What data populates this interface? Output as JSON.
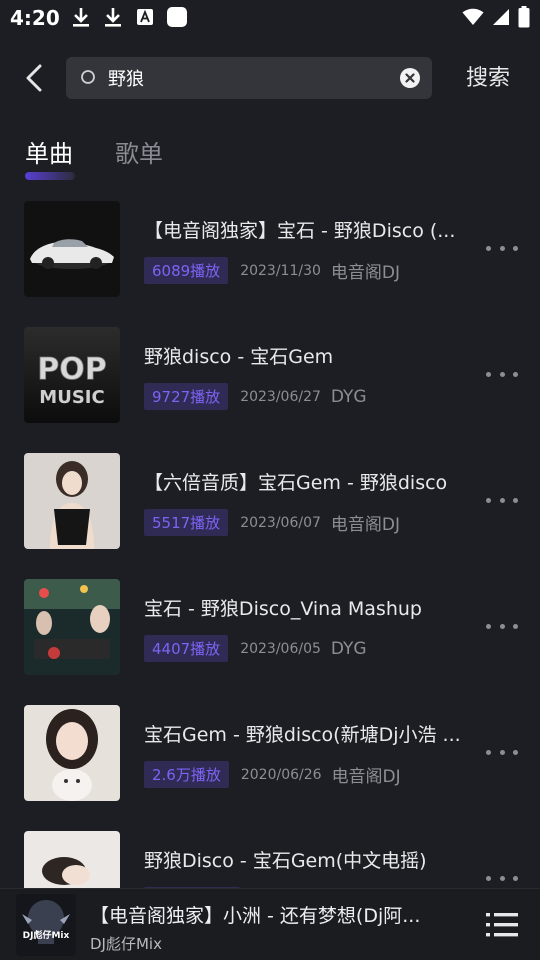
{
  "status_bar": {
    "time": "4:20",
    "left_icons": [
      "download-icon",
      "download-icon",
      "text-a-icon",
      "square-app-icon"
    ],
    "right_icons": [
      "wifi-icon",
      "signal-icon",
      "battery-icon"
    ]
  },
  "search": {
    "value": "野狼",
    "placeholder": "",
    "submit_label": "搜索"
  },
  "tabs": [
    {
      "label": "单曲",
      "active": true
    },
    {
      "label": "歌单",
      "active": false
    }
  ],
  "songs": [
    {
      "title": "【电音阁独家】宝石 - 野狼Disco (...",
      "plays": "6089播放",
      "date": "2023/11/30",
      "artist": "电音阁DJ",
      "cover": "car"
    },
    {
      "title": "野狼disco - 宝石Gem",
      "plays": "9727播放",
      "date": "2023/06/27",
      "artist": "DYG",
      "cover": "pop",
      "cover_text_1": "POP",
      "cover_text_2": "MUSIC"
    },
    {
      "title": "【六倍音质】宝石Gem - 野狼disco",
      "plays": "5517播放",
      "date": "2023/06/07",
      "artist": "电音阁DJ",
      "cover": "girl"
    },
    {
      "title": "宝石 - 野狼Disco_Vina Mashup",
      "plays": "4407播放",
      "date": "2023/06/05",
      "artist": "DYG",
      "cover": "club"
    },
    {
      "title": "宝石Gem - 野狼disco(新塘Dj小浩 ...",
      "plays": "2.6万播放",
      "date": "2020/06/26",
      "artist": "电音阁DJ",
      "cover": "cat"
    },
    {
      "title": "野狼Disco - 宝石Gem(中文电摇)",
      "plays": "",
      "date": "",
      "artist": "",
      "cover": "lying"
    }
  ],
  "player": {
    "title": "【电音阁独家】小洲 - 还有梦想(Dj阿...",
    "artist": "DJ彪仔Mix",
    "cover_text": "DJ彪仔Mix"
  },
  "colors": {
    "background": "#1d1e23",
    "accent": "#7e63f3",
    "badge_bg": "#2f2b55",
    "search_bg": "#34353b"
  }
}
